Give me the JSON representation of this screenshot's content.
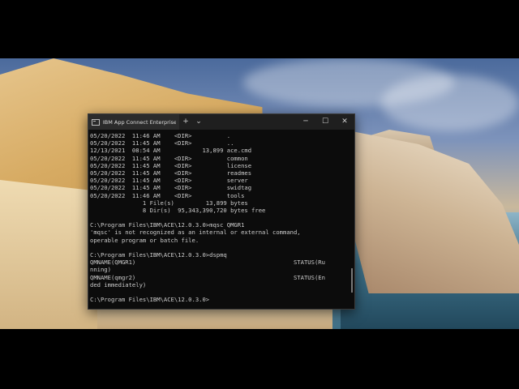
{
  "window": {
    "tab_title": "IBM App Connect Enterprise C",
    "new_tab": "+",
    "dropdown": "⌄",
    "minimize": "─",
    "maximize": "☐",
    "close": "✕"
  },
  "console_lines": [
    "05/20/2022  11:46 AM    <DIR>          .",
    "05/20/2022  11:45 AM    <DIR>          ..",
    "12/13/2021  08:54 AM            13,899 ace.cmd",
    "05/20/2022  11:45 AM    <DIR>          common",
    "05/20/2022  11:45 AM    <DIR>          license",
    "05/20/2022  11:45 AM    <DIR>          readmes",
    "05/20/2022  11:45 AM    <DIR>          server",
    "05/20/2022  11:45 AM    <DIR>          swidtag",
    "05/20/2022  11:46 AM    <DIR>          tools",
    "               1 File(s)         13,899 bytes",
    "               8 Dir(s)  95,343,390,720 bytes free",
    "",
    "C:\\Program Files\\IBM\\ACE\\12.0.3.0>mqsc QMGR1",
    "'mqsc' is not recognized as an internal or external command,",
    "operable program or batch file.",
    "",
    "C:\\Program Files\\IBM\\ACE\\12.0.3.0>dspmq",
    "QMNAME(QMGR1)                                             STATUS(Ru",
    "nning)",
    "QMNAME(qmgr2)                                             STATUS(En",
    "ded immediately)",
    "",
    "C:\\Program Files\\IBM\\ACE\\12.0.3.0>"
  ]
}
